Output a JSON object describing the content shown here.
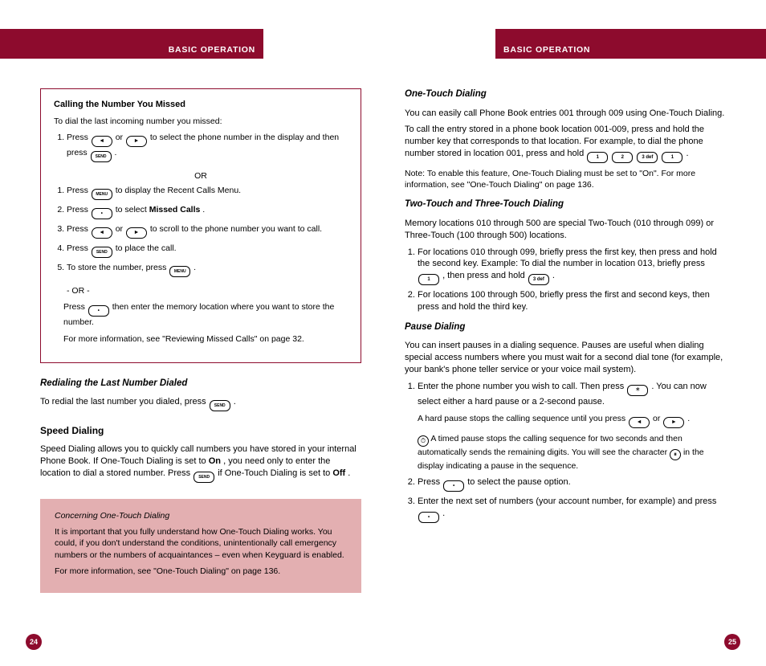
{
  "bannerLeft": "BASIC OPERATION",
  "bannerRight": "BASIC OPERATION",
  "left": {
    "boxTitle": "Calling the Number You Missed",
    "boxIntro": "To dial the last incoming number you missed:",
    "boxStep1_a": "Press ",
    "boxStep1_b": " or ",
    "boxStep1_c": " to select the phone number in the display and then press ",
    "boxStep1_d": ".",
    "boxStep2_a": "Press ",
    "boxStep2_b": " to display the Recent Calls Menu.",
    "boxStep3_a": "Press ",
    "boxStep3_b": " to select ",
    "boxStep3_c": "Missed Calls",
    "boxStep3_d": ".",
    "boxStep4_a": "Press ",
    "boxStep4_b": " or ",
    "boxStep4_c": " to scroll to the phone number you want to call.",
    "boxStep5_a": "Press ",
    "boxStep5_b": " to place the call.",
    "boxStep6_a": "To store the number, press ",
    "boxStep6_b": ".",
    "boxOr": "OR",
    "boxOr2": "- OR -",
    "boxStep7_a": "Press ",
    "boxStep7_b": " then enter the memory location where you want to store the number.",
    "box2_a": "For more information, see \"Reviewing Missed Calls\" on page 32.",
    "redialTitle": "Redialing the Last Number Dialed",
    "redial_a": "To redial the last number you dialed, press ",
    "redial_b": ".",
    "speedTitle": "Speed Dialing",
    "speed_a": "Speed Dialing allows you to quickly call numbers you have stored in your internal Phone Book. If One-Touch Dialing is set to ",
    "speed_b": "On",
    "speed_c": ", you need only to enter the location to dial a stored number. Press ",
    "speed_d": " if One-Touch Dialing is set to ",
    "speed_e": "Off",
    "speed_f": ".",
    "infoTitle": "Concerning One-Touch Dialing",
    "info_a": "It is important that you fully understand how One-Touch Dialing works. You could, if you don't understand the conditions, unintentionally call emergency numbers or the numbers of acquaintances – even when Keyguard is enabled.",
    "info_b": "For more information, see \"One-Touch Dialing\" on page 136."
  },
  "right": {
    "otTitle": "One-Touch Dialing",
    "ot_a": "You can easily call Phone Book entries 001 through 009 using One-Touch Dialing.",
    "ot_b": "To call the entry stored in a phone book location 001-009, press and hold the number key that corresponds to that location. For example, to dial the phone number stored in location 001, press and hold ",
    "ot_c": ".",
    "otNote": "Note: To enable this feature, One-Touch Dialing must be set to \"On\". For more information, see \"One-Touch Dialing\" on page 136.",
    "twoTitle": "Two-Touch and Three-Touch Dialing",
    "two_a": "Memory locations 010 through 500 are special Two-Touch (010 through 099) or Three-Touch (100 through 500) locations.",
    "two_s1_a": "For locations 010 through 099, briefly press the first key, then press and hold the second key. Example: To dial the number in location 013, briefly press ",
    "two_s1_b": ", then press and hold ",
    "two_s1_c": ".",
    "two_s2_a": "For locations 100 through 500, briefly press the first and second keys, then press and hold the third key.",
    "pauseTitle": "Pause Dialing",
    "pause_a": "You can insert pauses in a dialing sequence. Pauses are useful when dialing special access numbers where you must wait for a second dial tone (for example, your bank's phone teller service or your voice mail system).",
    "pauseStep1_a": "Enter the phone number you wish to call. Then press ",
    "pauseStep1_b": ". You can now select either a hard pause or a 2-second pause.",
    "pauseStep1_c": "A hard pause stops the calling sequence until you press ",
    "pauseStep1_d": " or ",
    "pauseStep1_e": ".",
    "pauseStep1_f": "A timed pause stops the calling sequence for two seconds and then automatically sends the remaining digits. You will see the character ",
    "pauseStep1_g": " in the display indicating a pause in the sequence.",
    "pauseStep2_a": "Press ",
    "pauseStep2_b": " to select the pause option.",
    "pauseStep3_a": "Enter the next set of numbers (your account number, for example) and press ",
    "pauseStep3_b": "."
  },
  "keys": {
    "left": "",
    "right": "",
    "send": "SEND",
    "menu": "MENU",
    "ok": "•",
    "one": "1",
    "two": "2",
    "three": "3 def",
    "star": "＊"
  },
  "pageLeft": "24",
  "pageRight": "25"
}
